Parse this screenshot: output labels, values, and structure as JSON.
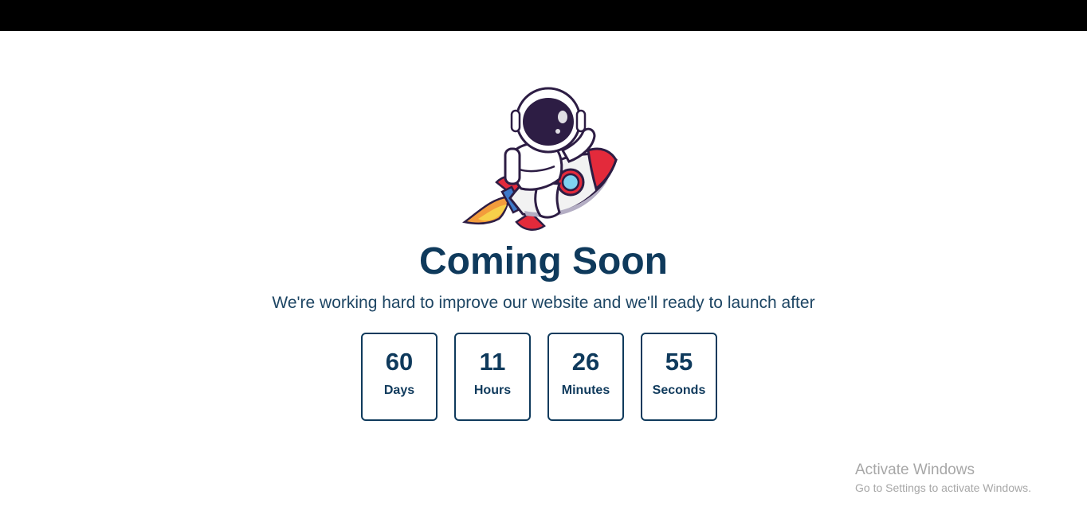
{
  "page": {
    "title": "Coming Soon",
    "subtitle": "We're working hard to improve our website and we'll ready to launch after"
  },
  "countdown": [
    {
      "value": "60",
      "label": "Days"
    },
    {
      "value": "11",
      "label": "Hours"
    },
    {
      "value": "26",
      "label": "Minutes"
    },
    {
      "value": "55",
      "label": "Seconds"
    }
  ],
  "illustration": {
    "icon": "astronaut-riding-rocket-icon"
  },
  "watermark": {
    "title": "Activate Windows",
    "subtitle": "Go to Settings to activate Windows."
  },
  "colors": {
    "heading": "#0f3a5c",
    "topbar": "#000000",
    "background": "#ffffff"
  }
}
